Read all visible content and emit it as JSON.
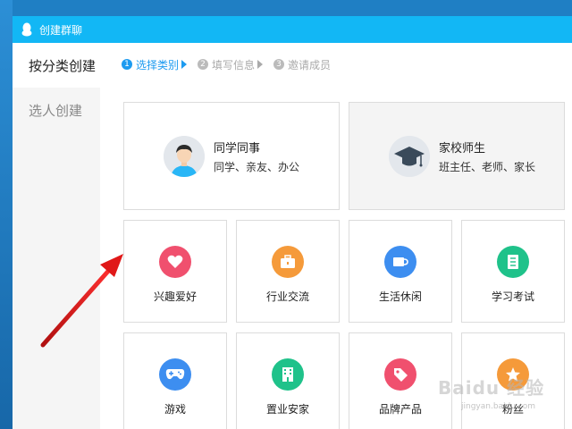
{
  "window": {
    "title": "创建群聊"
  },
  "sidebar": {
    "items": [
      {
        "label": "按分类创建",
        "active": true
      },
      {
        "label": "选人创建",
        "active": false
      }
    ]
  },
  "steps": [
    {
      "num": "1",
      "label": "选择类别",
      "active": true
    },
    {
      "num": "2",
      "label": "填写信息",
      "active": false
    },
    {
      "num": "3",
      "label": "邀请成员",
      "active": false
    }
  ],
  "big_cards": [
    {
      "title": "同学同事",
      "subtitle": "同学、亲友、办公",
      "icon": "student-avatar-icon"
    },
    {
      "title": "家校师生",
      "subtitle": "班主任、老师、家长",
      "icon": "graduation-cap-icon"
    }
  ],
  "categories": [
    {
      "label": "兴趣爱好",
      "icon": "heart-icon",
      "color": "#f0506e"
    },
    {
      "label": "行业交流",
      "icon": "briefcase-icon",
      "color": "#f59a3a"
    },
    {
      "label": "生活休闲",
      "icon": "cup-icon",
      "color": "#3d8ef0"
    },
    {
      "label": "学习考试",
      "icon": "document-icon",
      "color": "#1fc28a"
    },
    {
      "label": "游戏",
      "icon": "gamepad-icon",
      "color": "#3d8ef0"
    },
    {
      "label": "置业安家",
      "icon": "building-icon",
      "color": "#1fc28a"
    },
    {
      "label": "品牌产品",
      "icon": "tag-icon",
      "color": "#f0506e"
    },
    {
      "label": "粉丝",
      "icon": "star-icon",
      "color": "#f59a3a"
    }
  ],
  "watermark": {
    "text": "Baidu 经验",
    "sub": "jingyan.baidu.com"
  }
}
